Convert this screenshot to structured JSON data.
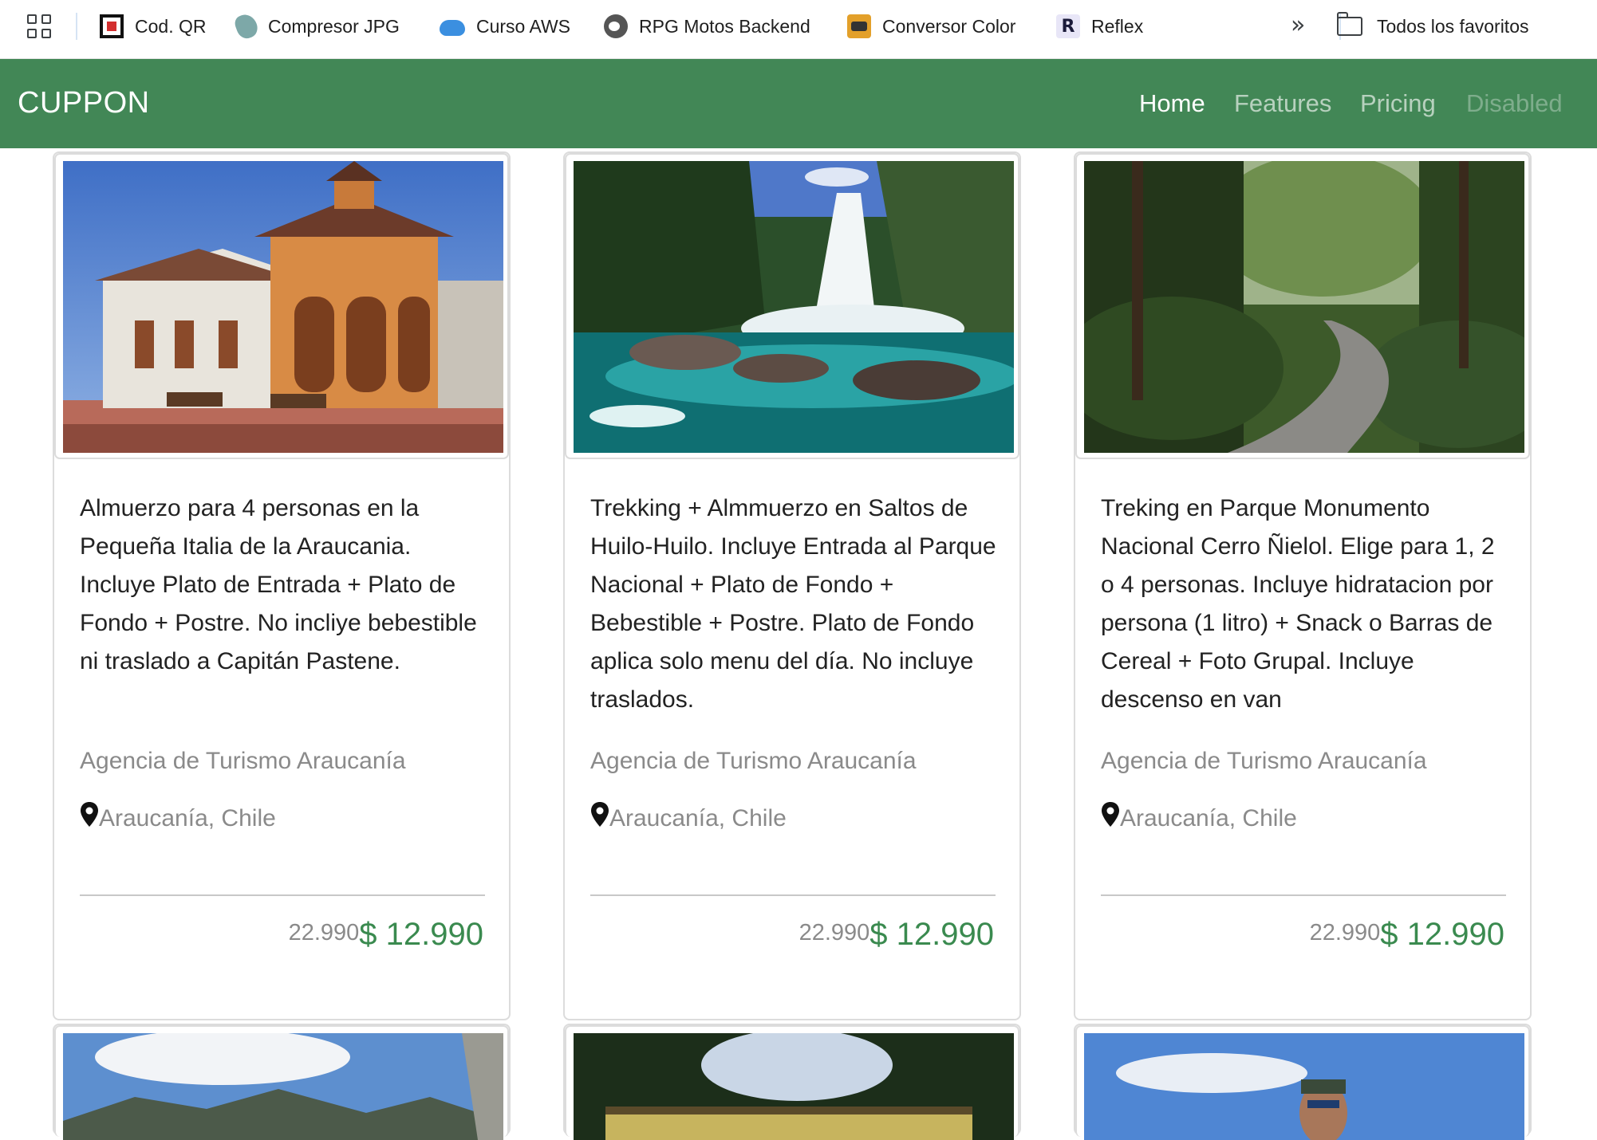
{
  "bookmarks_bar": {
    "items": [
      {
        "label": "Cod. QR",
        "icon": "qr-code-icon"
      },
      {
        "label": "Compresor JPG",
        "icon": "jpg-compressor-icon"
      },
      {
        "label": "Curso AWS",
        "icon": "cloud-icon"
      },
      {
        "label": "RPG Motos Backend",
        "icon": "rpg-icon"
      },
      {
        "label": "Conversor Color",
        "icon": "color-converter-icon"
      },
      {
        "label": "Reflex",
        "icon": "reflex-icon",
        "icon_glyph": "R"
      }
    ],
    "overflow_glyph": "»",
    "all_bookmarks_label": "Todos los favoritos"
  },
  "navbar": {
    "brand": "CUPPON",
    "links": [
      "Home",
      "Features",
      "Pricing",
      "Disabled"
    ],
    "color": "#428756"
  },
  "cards": [
    {
      "image": "building-photo",
      "description": "Almuerzo para 4 personas en la Pequeña Italia de la Araucania. Incluye Plato de Entrada + Plato de Fondo + Postre. No incliye bebestible ni traslado a Capitán Pastene.",
      "agency": "Agencia de Turismo Araucanía",
      "location": "Araucanía, Chile",
      "old_price": "22.990",
      "price": "$ 12.990"
    },
    {
      "image": "waterfall-photo",
      "description": "Trekking + Almmuerzo en Saltos de Huilo-Huilo. Incluye Entrada al Parque Nacional + Plato de Fondo + Bebestible + Postre. Plato de Fondo aplica solo menu del día. No incluye traslados.",
      "agency": "Agencia de Turismo Araucanía",
      "location": "Araucanía, Chile",
      "old_price": "22.990",
      "price": "$ 12.990"
    },
    {
      "image": "forest-road-photo",
      "description": "Treking en Parque Monumento Nacional Cerro Ñielol. Elige para 1, 2 o 4 personas. Incluye hidratacion por persona (1 litro) + Snack o Barras de Cereal + Foto Grupal. Incluye descenso en van",
      "agency": "Agencia de Turismo Araucanía",
      "location": "Araucanía, Chile",
      "old_price": "22.990",
      "price": "$ 12.990"
    }
  ],
  "colors": {
    "price_green": "#3a8a4f",
    "muted_text": "#8a8a8a"
  }
}
